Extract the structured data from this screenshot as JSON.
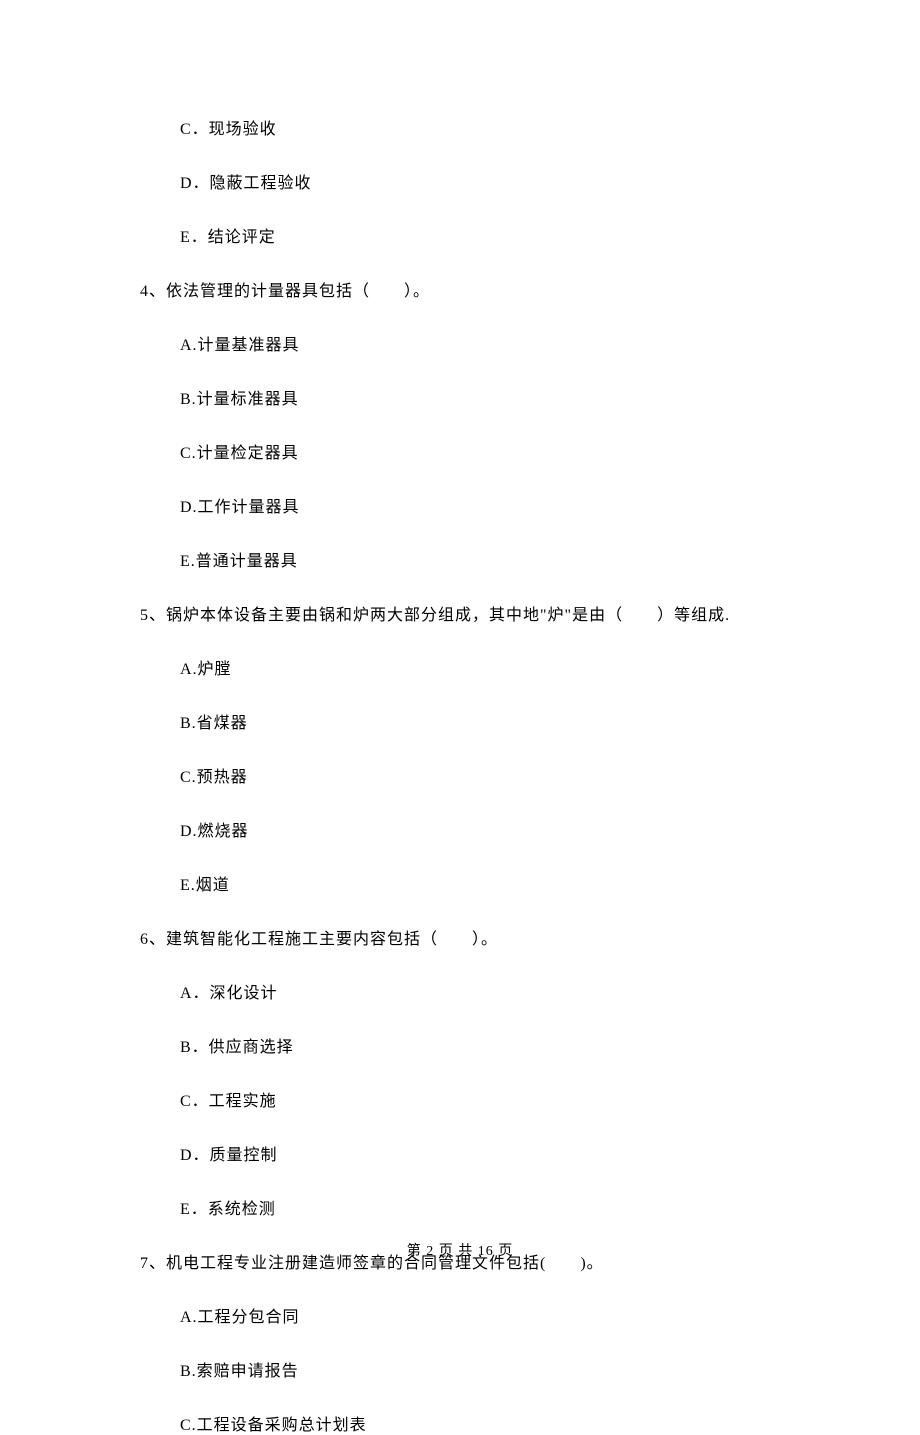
{
  "options_pre": [
    "C．现场验收",
    "D．隐蔽工程验收",
    "E．结论评定"
  ],
  "questions": [
    {
      "stem": "4、依法管理的计量器具包括（　　）。",
      "options": [
        "A.计量基准器具",
        "B.计量标准器具",
        "C.计量检定器具",
        "D.工作计量器具",
        "E.普通计量器具"
      ]
    },
    {
      "stem": "5、锅炉本体设备主要由锅和炉两大部分组成，其中地\"炉\"是由（　　）等组成.",
      "options": [
        "A.炉膛",
        "B.省煤器",
        "C.预热器",
        "D.燃烧器",
        "E.烟道"
      ]
    },
    {
      "stem": "6、建筑智能化工程施工主要内容包括（　　）。",
      "options": [
        "A．深化设计",
        "B．供应商选择",
        "C．工程实施",
        "D．质量控制",
        "E．系统检测"
      ]
    },
    {
      "stem": "7、机电工程专业注册建造师签章的合同管理文件包括(　　)。",
      "options": [
        "A.工程分包合同",
        "B.索赔申请报告",
        "C.工程设备采购总计划表"
      ]
    }
  ],
  "footer": "第 2 页 共 16 页"
}
